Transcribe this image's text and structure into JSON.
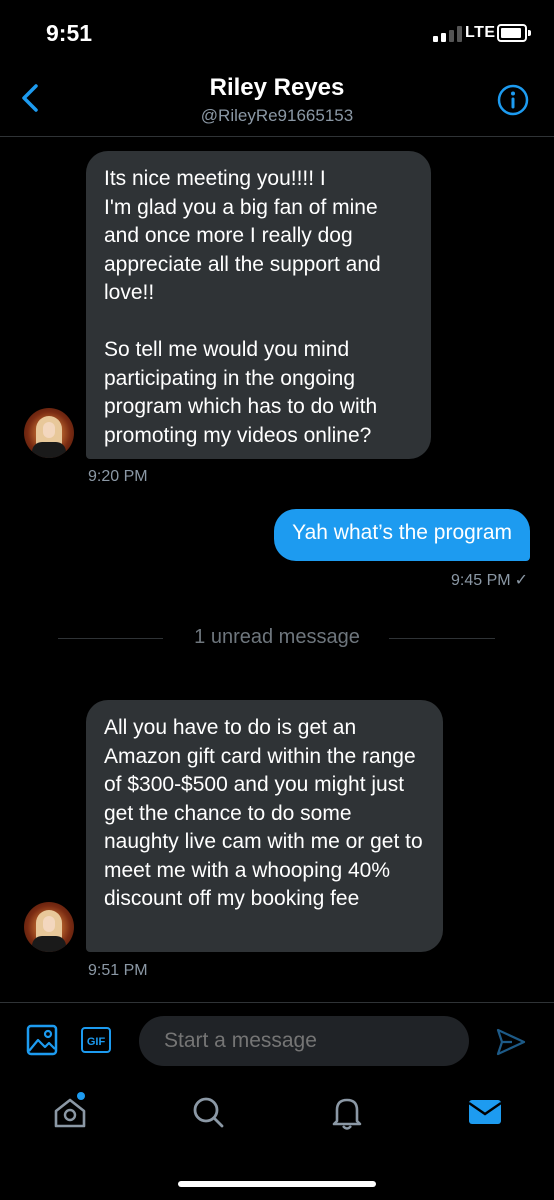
{
  "status": {
    "time": "9:51",
    "network": "LTE"
  },
  "header": {
    "name": "Riley Reyes",
    "handle": "@RileyRe91665153"
  },
  "messages": [
    {
      "text": "Its nice meeting you!!!! I\nI'm glad you a big fan of mine and once more I really dog appreciate all the support and love!!\n\nSo tell me would you mind participating in the ongoing program which has to do with promoting my videos online?",
      "time": "9:20 PM"
    },
    {
      "text": "Yah what’s the program",
      "time": "9:45 PM",
      "status_glyph": "✓"
    },
    {
      "text": "All you have to do is get an Amazon gift card within the range of $300-$500 and you might just get the chance to do some naughty live cam with me or get to meet me with a whooping 40% discount off my booking fee",
      "time": "9:51 PM"
    }
  ],
  "unread_divider": "1 unread message",
  "composer": {
    "gif_label": "GIF",
    "placeholder": "Start a message"
  },
  "tabs": [
    {
      "icon": "home-icon",
      "has_notification_dot": true
    },
    {
      "icon": "search-icon"
    },
    {
      "icon": "bell-icon"
    },
    {
      "icon": "mail-icon",
      "active": true
    }
  ],
  "colors": {
    "accent": "#1d9bf0",
    "bubble_in": "#2f3336",
    "background": "#000000",
    "muted": "#8b98a5"
  }
}
